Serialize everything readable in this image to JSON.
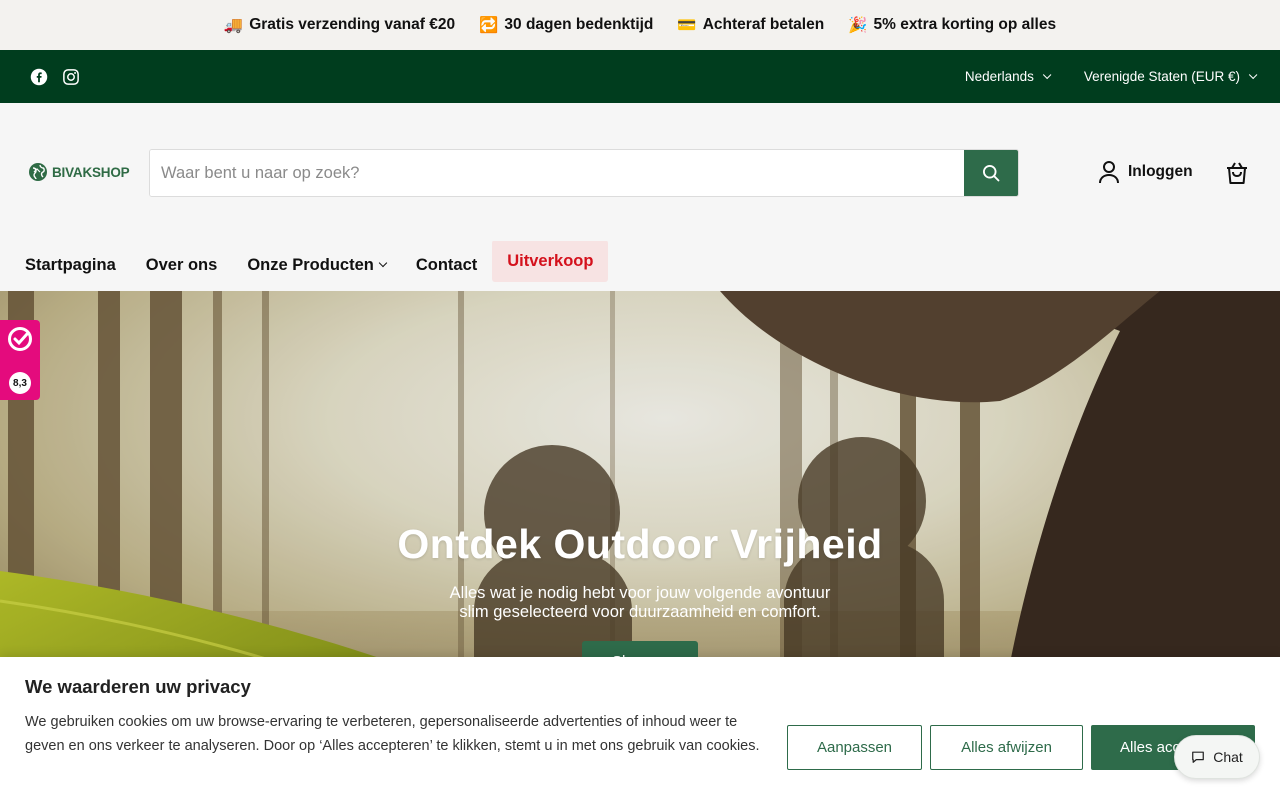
{
  "announcement": {
    "items": [
      {
        "emoji": "🚚",
        "text": "Gratis verzending vanaf €20"
      },
      {
        "emoji": "🔁",
        "text": "30 dagen bedenktijd"
      },
      {
        "emoji": "💳",
        "text": "Achteraf betalen"
      },
      {
        "emoji": "🎉",
        "text": "5% extra korting op alles"
      }
    ]
  },
  "utility": {
    "social": [
      "facebook-icon",
      "instagram-icon"
    ],
    "language": "Nederlands",
    "currency": "Verenigde Staten (EUR €)"
  },
  "header": {
    "logo_text": "BIVAKSHOP",
    "search_placeholder": "Waar bent u naar op zoek?",
    "login_label": "Inloggen"
  },
  "nav": {
    "items": [
      "Startpagina",
      "Over ons",
      "Onze Producten",
      "Contact",
      "Uitverkoop"
    ]
  },
  "hero": {
    "title": "Ontdek Outdoor Vrijheid",
    "subtitle_line1": "Alles wat je nodig hebt voor jouw volgende avontuur",
    "subtitle_line2": "slim geselecteerd voor duurzaamheid en comfort.",
    "cta": "Shop nu"
  },
  "review_widget": {
    "score": "8,3"
  },
  "cookie": {
    "title": "We waarderen uw privacy",
    "text": "We gebruiken cookies om uw browse-ervaring te verbeteren, gepersonaliseerde advertenties of inhoud weer te geven en ons verkeer te analyseren. Door op ‘Alles accepteren’ te klikken, stemt u in met ons gebruik van cookies.",
    "customize": "Aanpassen",
    "reject": "Alles afwijzen",
    "accept": "Alles accepteren"
  },
  "chat": {
    "label": "Chat"
  },
  "colors": {
    "brand_green": "#2e6b4a",
    "dark_green": "#003d1e",
    "sale_red": "#d4111c",
    "review_pink": "#e40b7d"
  }
}
